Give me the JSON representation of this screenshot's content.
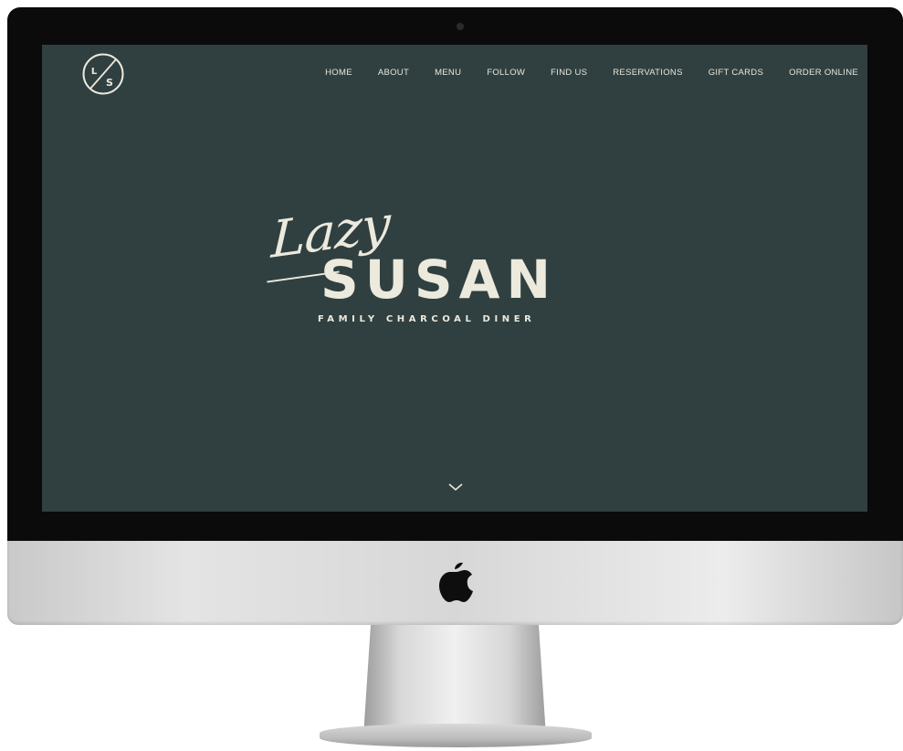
{
  "brand": {
    "logo_letters": [
      "L",
      "S"
    ],
    "colors": {
      "screen_bg": "#304040",
      "text": "#ece9dd"
    }
  },
  "nav": {
    "items": [
      {
        "label": "HOME"
      },
      {
        "label": "ABOUT"
      },
      {
        "label": "MENU"
      },
      {
        "label": "FOLLOW"
      },
      {
        "label": "FIND US"
      },
      {
        "label": "RESERVATIONS"
      },
      {
        "label": "GIFT CARDS"
      },
      {
        "label": "ORDER ONLINE"
      }
    ]
  },
  "hero": {
    "script_word": "Lazy",
    "name": "SUSAN",
    "tagline": "FAMILY CHARCOAL DINER"
  },
  "icons": {
    "scroll": "chevron-down-icon",
    "device_logo": "apple-logo-icon"
  }
}
